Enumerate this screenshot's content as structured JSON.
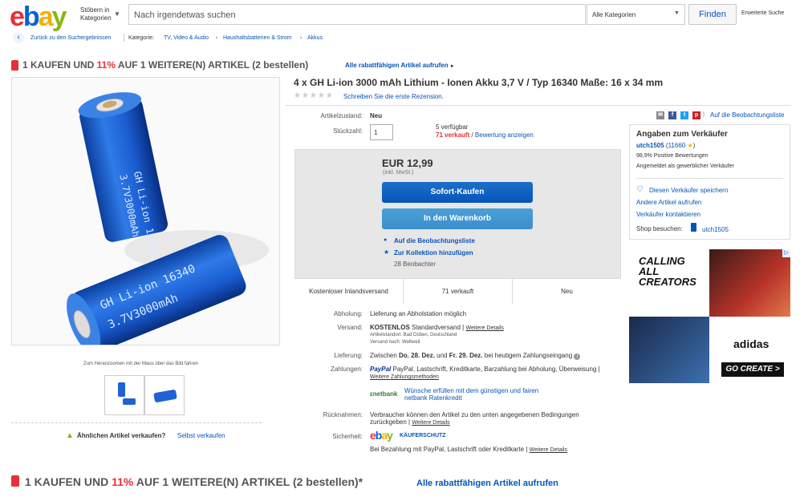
{
  "header": {
    "browse_label": "Stöbern in Kategorien",
    "search_placeholder": "Nach irgendetwas suchen",
    "category_select": "Alle Kategorien",
    "find_button": "Finden",
    "advanced_search": "Erweiterte Suche"
  },
  "breadcrumb": {
    "back": "Zurück zu den Suchergebnissen",
    "category_label": "Kategorie:",
    "items": [
      "TV, Video & Audio",
      "Haushaltsbatterien & Strom",
      "Akkus"
    ]
  },
  "promo": {
    "prefix": "1 KAUFEN UND ",
    "percent": "11%",
    "suffix": " AUF 1 WEITERE(N) ARTIKEL (2 bestellen)",
    "link": "Alle rabattfähigen Artikel aufrufen",
    "bottom_suffix": " AUF 1 WEITERE(N) ARTIKEL (2 bestellen)*"
  },
  "image": {
    "zoom_hint": "Zum Heranzoomen mit der Maus über das Bild fahren",
    "battery_text_1": "GH Li-ion 16340",
    "battery_text_2": "3.7V3000mAh"
  },
  "sell_similar": {
    "question": "Ähnlichen Artikel verkaufen?",
    "link": "Selbst verkaufen"
  },
  "item": {
    "title": "4 x GH Li-ion 3000 mAh Lithium - Ionen Akku 3,7 V / Typ 16340 Maße: 16 x 34 mm",
    "review_link": "Schreiben Sie die erste Rezension.",
    "condition_label": "Artikelzustand:",
    "condition": "Neu",
    "quantity_label": "Stückzahl:",
    "quantity": "1",
    "available": "5 verfügbar",
    "sold": "71 verkauft",
    "ratings_link": "Bewertung anzeigen",
    "watch_link": "Auf die Beobachtungsliste"
  },
  "buybox": {
    "price": "EUR 12,99",
    "tax": "(inkl. MwSt.)",
    "buy_now": "Sofort-Kaufen",
    "add_to_cart": "In den Warenkorb",
    "watch": "Auf die Beobachtungsliste",
    "collection": "Zur Kollektion hinzufügen",
    "watchers": "28 Beobachter",
    "footer": [
      "Kostenloser Inlandsversand",
      "71 verkauft",
      "Neu"
    ]
  },
  "details": {
    "pickup_label": "Abholung:",
    "pickup": "Lieferung an Abholstation möglich",
    "shipping_label": "Versand:",
    "shipping_free": "KOSTENLOS",
    "shipping_type": "Standardversand",
    "more_details": "Weitere Details",
    "location": "Artikelstandort: Bad Düben, Deutschland",
    "ships_to": "Versand nach: Weltweit",
    "delivery_label": "Lieferung:",
    "delivery_prefix": "Zwischen ",
    "delivery_date1": "Do. 28. Dez.",
    "delivery_mid": " und ",
    "delivery_date2": "Fr. 29. Dez.",
    "delivery_suffix": " bei heutigem Zahlungseingang",
    "payment_label": "Zahlungen:",
    "payment_methods": "PayPal, Lastschrift, Kreditkarte, Barzahlung bei Abholung, Überweisung",
    "payment_more": "Weitere Zahlungsmethoden",
    "payment_logo": "PayPal",
    "netbank_logo": "netbank",
    "netbank_text": "Wünsche erfüllen mit dem günstigen und fairen netbank Ratenkredit",
    "returns_label": "Rücknahmen:",
    "returns": "Verbraucher können den Artikel zu den unten angegebenen Bedingungen zurückgeben",
    "security_label": "Sicherheit:",
    "ebay_protection": "KÄUFERSCHUTZ",
    "security_text": "Bei Bezahlung mit PayPal, Lastschrift oder Kreditkarte"
  },
  "seller": {
    "heading": "Angaben zum Verkäufer",
    "name": "utch1505",
    "score": "11660",
    "positive": "98,9% Positive Bewertungen",
    "registered": "Angemeldet als gewerblicher Verkäufer",
    "save": "Diesen Verkäufer speichern",
    "other_items": "Andere Artikel aufrufen",
    "contact": "Verkäufer kontaktieren",
    "shop_label": "Shop besuchen:",
    "shop_name": "utch1505"
  },
  "ad": {
    "headline": "CALLING ALL CREATORS",
    "brand": "adidas",
    "cta": "GO CREATE >"
  },
  "colors": {
    "accent": "#0654ba",
    "promo_red": "#e53238"
  }
}
